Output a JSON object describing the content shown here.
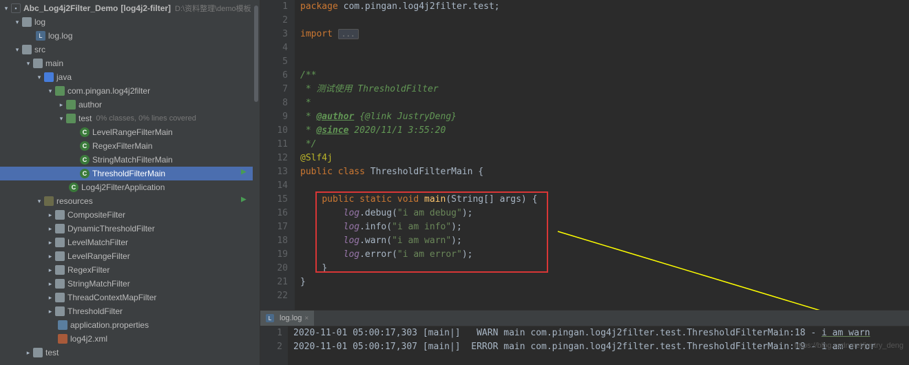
{
  "project": {
    "name": "Abc_Log4j2Filter_Demo",
    "module": "[log4j2-filter]",
    "path": "D:\\资料整理\\demo模板"
  },
  "tree": {
    "log": "log",
    "loglog": "log.log",
    "src": "src",
    "main_": "main",
    "java": "java",
    "pkg": "com.pingan.log4j2filter",
    "author": "author",
    "test": "test",
    "test_hint": "0% classes, 0% lines covered",
    "c1": "LevelRangeFilterMain",
    "c2": "RegexFilterMain",
    "c3": "StringMatchFilterMain",
    "c4": "ThresholdFilterMain",
    "c5": "Log4j2FilterApplication",
    "resources": "resources",
    "r1": "CompositeFilter",
    "r2": "DynamicThresholdFilter",
    "r3": "LevelMatchFilter",
    "r4": "LevelRangeFilter",
    "r5": "RegexFilter",
    "r6": "StringMatchFilter",
    "r7": "ThreadContextMapFilter",
    "r8": "ThresholdFilter",
    "app_props": "application.properties",
    "log4j2xml": "log4j2.xml",
    "test2": "test"
  },
  "code": {
    "l1a": "package",
    "l1b": " com.pingan.log4j2filter.test;",
    "l3a": "import",
    "l3b": "...",
    "l6": "/**",
    "l7": " * 测试使用 ThresholdFilter",
    "l8": " *",
    "l9a": " * ",
    "l9b": "@author",
    "l9c": " {@link JustryDeng}",
    "l10a": " * ",
    "l10b": "@since",
    "l10c": " 2020/11/1 3:55:20",
    "l11": " */",
    "l12": "@Slf4j",
    "l13a": "public class ",
    "l13b": "ThresholdFilterMain",
    "l13c": " {",
    "l15a": "public static ",
    "l15b": "void ",
    "l15c": "main",
    "l15d": "(String[] args) {",
    "l16a": "log",
    "l16b": ".debug(",
    "l16c": "\"i am debug\"",
    "l16d": ");",
    "l17a": "log",
    "l17b": ".info(",
    "l17c": "\"i am info\"",
    "l17d": ");",
    "l18a": "log",
    "l18b": ".warn(",
    "l18c": "\"i am warn\"",
    "l18d": ");",
    "l19a": "log",
    "l19b": ".error(",
    "l19c": "\"i am error\"",
    "l19d": ");",
    "l20": "}",
    "l21": "}"
  },
  "gutter": {
    "n1": "1",
    "n2": "2",
    "n3": "3",
    "n4": "4",
    "n5": "5",
    "n6": "6",
    "n7": "7",
    "n8": "8",
    "n9": "9",
    "n10": "10",
    "n11": "11",
    "n12": "12",
    "n13": "13",
    "n14": "14",
    "n15": "15",
    "n16": "16",
    "n17": "17",
    "n18": "18",
    "n19": "19",
    "n20": "20",
    "n21": "21",
    "n22": "22"
  },
  "tab": {
    "label": "log.log",
    "close": "×"
  },
  "console": {
    "g1": "1",
    "g2": "2",
    "l1a": "2020-11-01 05:00:17,303 [main|]   WARN main com.pingan.log4j2filter.test.ThresholdFilterMain:18 - ",
    "l1b": "i am warn",
    "l2": "2020-11-01 05:00:17,307 [main|]  ERROR main com.pingan.log4j2filter.test.ThresholdFilterMain:19 - i am error"
  },
  "watermark": "https://blog.csdn.net/justry_deng"
}
